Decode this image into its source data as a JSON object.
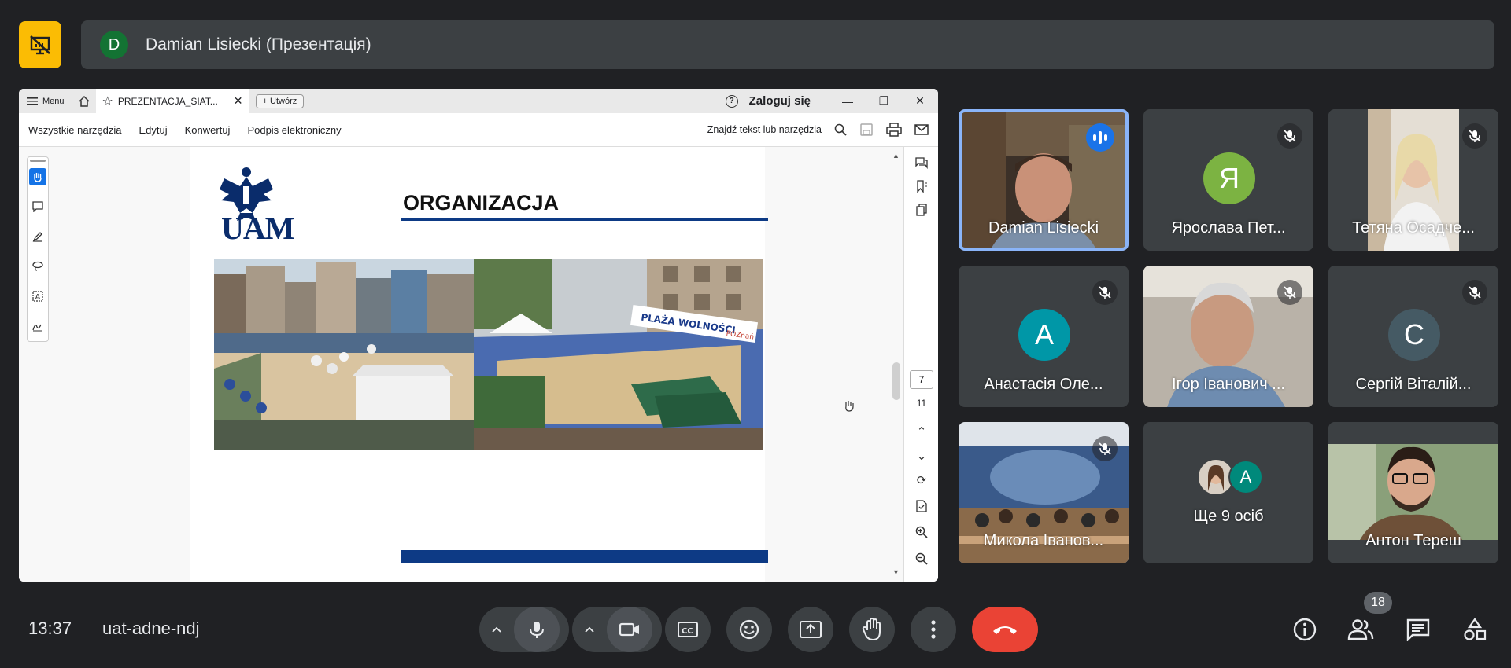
{
  "presenter": {
    "initial": "D",
    "avatar_color": "#137333",
    "label": "Damian Lisiecki (Презентація)"
  },
  "pdf_viewer": {
    "menu_label": "Menu",
    "tab_title": "PREZENTACJA_SIAT...",
    "new_tab_label": "Utwórz",
    "signin_label": "Zaloguj się",
    "toolbar": [
      "Wszystkie narzędzia",
      "Edytuj",
      "Konwertuj",
      "Podpis elektroniczny"
    ],
    "find_placeholder": "Znajdź tekst lub narzędzia",
    "current_page": "7",
    "total_pages": "11"
  },
  "slide": {
    "logo_text": "UAM",
    "title": "ORGANIZACJA",
    "banner_text": "PLAŻA WOLNOŚCI",
    "banner_text2": "POZnań"
  },
  "participants": [
    {
      "name": "Damian Lisiecki",
      "type": "video",
      "speaking": true,
      "muted": false
    },
    {
      "name": "Ярослава Пет...",
      "type": "avatar",
      "initial": "Я",
      "color": "#7cb342",
      "muted": true
    },
    {
      "name": "Тетяна Осадче...",
      "type": "video",
      "muted": true
    },
    {
      "name": "Анастасія Оле...",
      "type": "avatar",
      "initial": "А",
      "color": "#0097a7",
      "muted": true
    },
    {
      "name": "Ігор Іванович ...",
      "type": "video",
      "muted": true
    },
    {
      "name": "Сергій Віталій...",
      "type": "avatar",
      "initial": "С",
      "color": "#455a64",
      "muted": true
    },
    {
      "name": "Микола Іванов...",
      "type": "video",
      "muted": true
    },
    {
      "name": "Ще 9 осіб",
      "type": "more",
      "initial": "А",
      "color": "#00897b"
    },
    {
      "name": "Антон Тереш",
      "type": "video",
      "muted": false
    }
  ],
  "bottom": {
    "time": "13:37",
    "meeting_code": "uat-adne-ndj",
    "people_count": "18"
  },
  "colors": {
    "background": "#202124",
    "tile": "#3c4043",
    "hangup": "#ea4335",
    "present_button": "#fbbc04",
    "speaking": "#8ab4f8"
  }
}
